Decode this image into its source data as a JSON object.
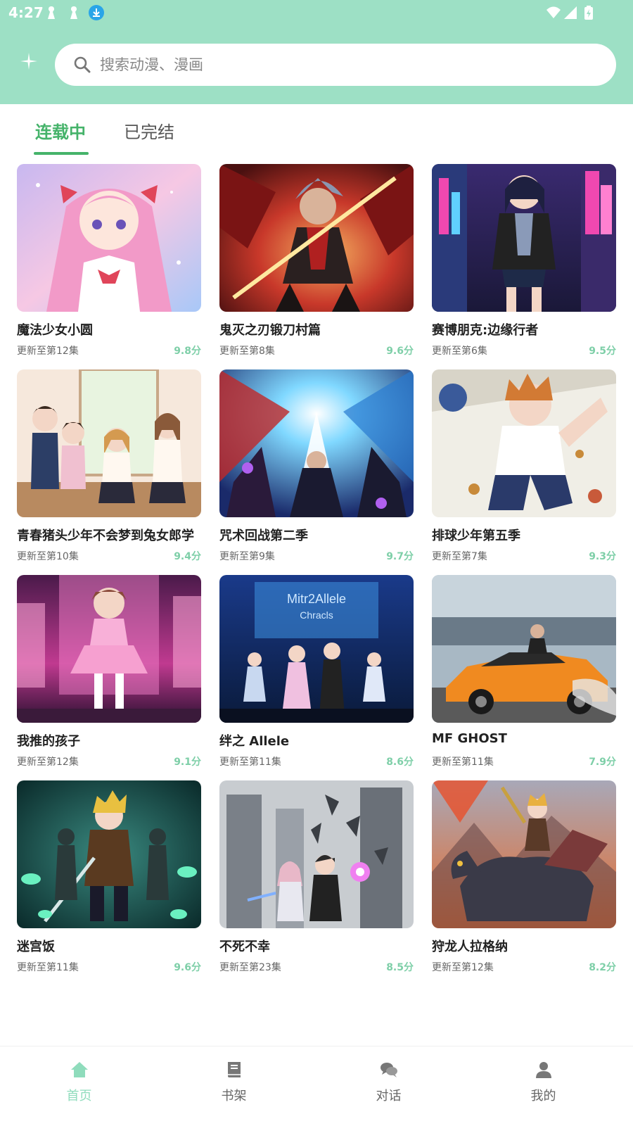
{
  "status_bar": {
    "time": "4:27"
  },
  "search": {
    "placeholder": "搜索动漫、漫画"
  },
  "tabs": [
    {
      "label": "连载中",
      "active": true
    },
    {
      "label": "已完结",
      "active": false
    }
  ],
  "accent_color": "#45b36a",
  "header_color": "#9de0c5",
  "score_color": "#7ecfa8",
  "items": [
    {
      "title": "魔法少女小圆",
      "episode": "更新至第12集",
      "score": "9.8分",
      "thumb": "pink"
    },
    {
      "title": "鬼灭之刃锻刀村篇",
      "episode": "更新至第8集",
      "score": "9.6分",
      "thumb": "red"
    },
    {
      "title": "赛博朋克:边缘行者",
      "episode": "更新至第6集",
      "score": "9.5分",
      "thumb": "neon"
    },
    {
      "title": "青春猪头少年不会梦到兔女郎学",
      "episode": "更新至第10集",
      "score": "9.4分",
      "thumb": "school"
    },
    {
      "title": "咒术回战第二季",
      "episode": "更新至第9集",
      "score": "9.7分",
      "thumb": "blue"
    },
    {
      "title": "排球少年第五季",
      "episode": "更新至第7集",
      "score": "9.3分",
      "thumb": "sport"
    },
    {
      "title": "我推的孩子",
      "episode": "更新至第12集",
      "score": "9.1分",
      "thumb": "idol"
    },
    {
      "title": "绊之 Allele",
      "episode": "更新至第11集",
      "score": "8.6分",
      "thumb": "stage"
    },
    {
      "title": "MF GHOST",
      "episode": "更新至第11集",
      "score": "7.9分",
      "thumb": "car"
    },
    {
      "title": "迷宫饭",
      "episode": "更新至第11集",
      "score": "9.6分",
      "thumb": "dungeon"
    },
    {
      "title": "不死不幸",
      "episode": "更新至第23集",
      "score": "8.5分",
      "thumb": "city"
    },
    {
      "title": "狩龙人拉格纳",
      "episode": "更新至第12集",
      "score": "8.2分",
      "thumb": "dragon"
    }
  ],
  "thumb_art": {
    "pink": "Mitr2Allele",
    "stage_sign_line1": "Mitr2Allele",
    "stage_sign_line2": "Chracls"
  },
  "nav": [
    {
      "label": "首页",
      "icon": "home-icon",
      "active": true
    },
    {
      "label": "书架",
      "icon": "book-icon",
      "active": false
    },
    {
      "label": "对话",
      "icon": "chat-icon",
      "active": false
    },
    {
      "label": "我的",
      "icon": "user-icon",
      "active": false
    }
  ]
}
